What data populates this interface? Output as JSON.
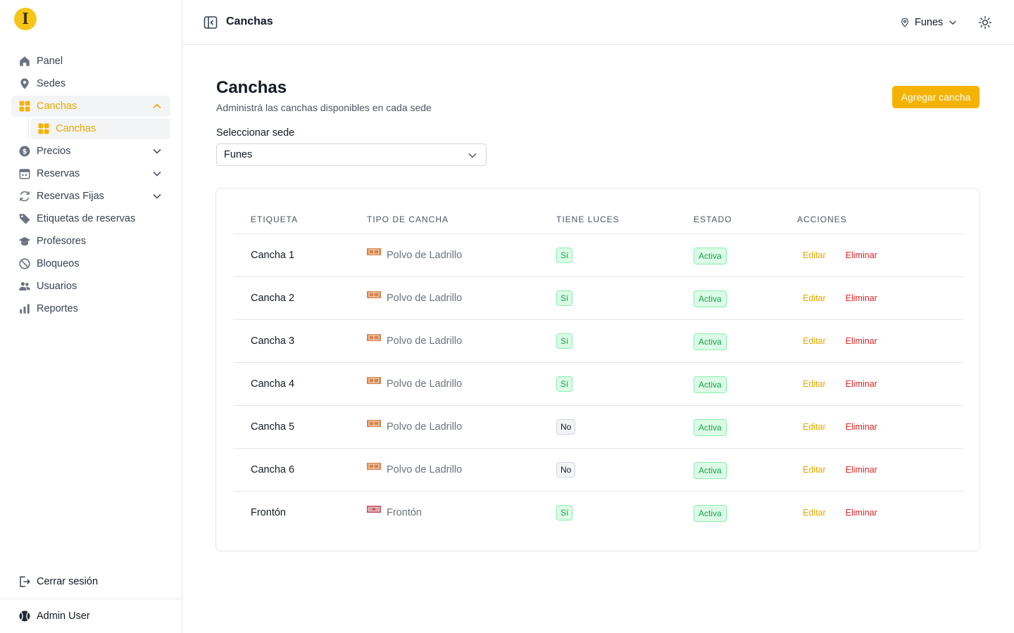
{
  "sidebar": {
    "logo_letter": "I",
    "items": [
      {
        "label": "Panel",
        "icon": "home-icon"
      },
      {
        "label": "Sedes",
        "icon": "map-pin-icon"
      },
      {
        "label": "Canchas",
        "icon": "grid-icon",
        "active": true,
        "expanded": true
      },
      {
        "label": "Canchas",
        "icon": "grid-icon",
        "sub": true,
        "active": true
      },
      {
        "label": "Precios",
        "icon": "dollar-icon"
      },
      {
        "label": "Reservas",
        "icon": "calendar-icon"
      },
      {
        "label": "Reservas Fijas",
        "icon": "refresh-icon"
      },
      {
        "label": "Etiquetas de reservas",
        "icon": "tag-icon"
      },
      {
        "label": "Profesores",
        "icon": "graduation-cap-icon"
      },
      {
        "label": "Bloqueos",
        "icon": "block-icon"
      },
      {
        "label": "Usuarios",
        "icon": "users-icon"
      },
      {
        "label": "Reportes",
        "icon": "bar-chart-icon"
      }
    ],
    "logout_label": "Cerrar sesión",
    "user_name": "Admin User"
  },
  "topbar": {
    "title": "Canchas",
    "venue": "Funes"
  },
  "main": {
    "title": "Canchas",
    "subtitle": "Administrá las canchas disponibles en cada sede",
    "add_button": "Agregar cancha",
    "select_label": "Seleccionar sede",
    "select_value": "Funes",
    "table": {
      "headers": [
        "ETIQUETA",
        "TIPO DE CANCHA",
        "TIENE LUCES",
        "ESTADO",
        "ACCIONES"
      ],
      "rows": [
        {
          "label": "Cancha 1",
          "type": "Polvo de Ladrillo",
          "lights": "Sí",
          "state": "Activa"
        },
        {
          "label": "Cancha 2",
          "type": "Polvo de Ladrillo",
          "lights": "Sí",
          "state": "Activa"
        },
        {
          "label": "Cancha 3",
          "type": "Polvo de Ladrillo",
          "lights": "Sí",
          "state": "Activa"
        },
        {
          "label": "Cancha 4",
          "type": "Polvo de Ladrillo",
          "lights": "Sí",
          "state": "Activa"
        },
        {
          "label": "Cancha 5",
          "type": "Polvo de Ladrillo",
          "lights": "No",
          "state": "Activa"
        },
        {
          "label": "Cancha 6",
          "type": "Polvo de Ladrillo",
          "lights": "No",
          "state": "Activa"
        },
        {
          "label": "Frontón",
          "type": "Frontón",
          "lights": "Sí",
          "state": "Activa"
        }
      ],
      "edit_label": "Editar",
      "delete_label": "Eliminar"
    }
  },
  "colors": {
    "accent": "#f5b301",
    "success": "#16a34a",
    "danger": "#dc2626"
  }
}
